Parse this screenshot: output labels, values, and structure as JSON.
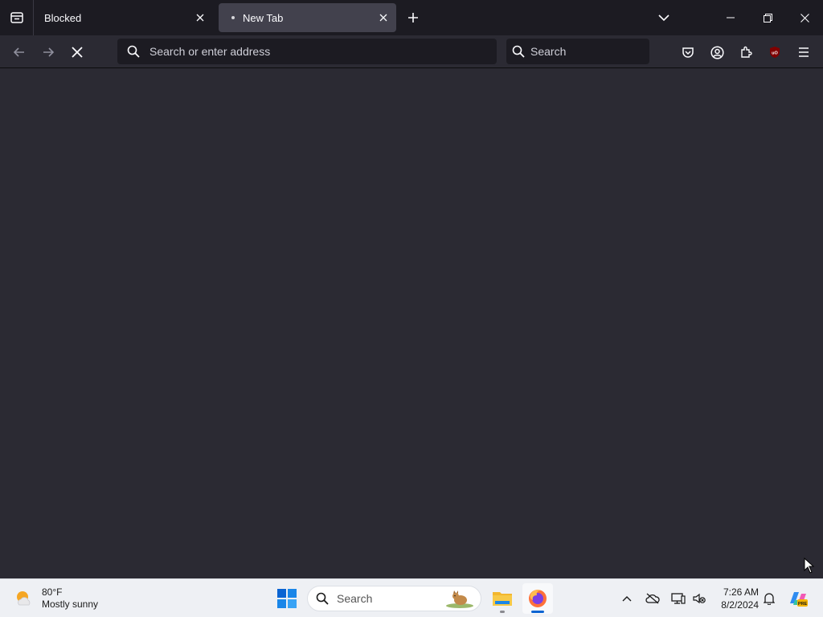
{
  "browser": {
    "tabs": [
      {
        "title": "Blocked",
        "active": false
      },
      {
        "title": "New Tab",
        "active": true
      }
    ],
    "urlbar": {
      "placeholder": "Search or enter address",
      "value": ""
    },
    "searchbar": {
      "placeholder": "Search",
      "value": ""
    },
    "toolbar_icons": [
      "back-icon",
      "forward-icon",
      "stop-loading-icon",
      "pocket-icon",
      "account-icon",
      "extensions-icon",
      "ublock-origin-icon",
      "menu-icon"
    ],
    "accent_color": "#42414d",
    "background_color": "#2b2a33"
  },
  "taskbar": {
    "weather": {
      "temperature": "80°F",
      "condition": "Mostly sunny"
    },
    "search": {
      "label": "Search"
    },
    "clock": {
      "time": "7:26 AM",
      "date": "8/2/2024"
    },
    "apps": [
      "windows-start-icon",
      "file-explorer-icon",
      "firefox-icon"
    ],
    "tray_icons": [
      "chevron-up-icon",
      "onedrive-icon",
      "network-icon",
      "phone-link-icon",
      "notification-bell-icon",
      "copilot-icon"
    ]
  }
}
